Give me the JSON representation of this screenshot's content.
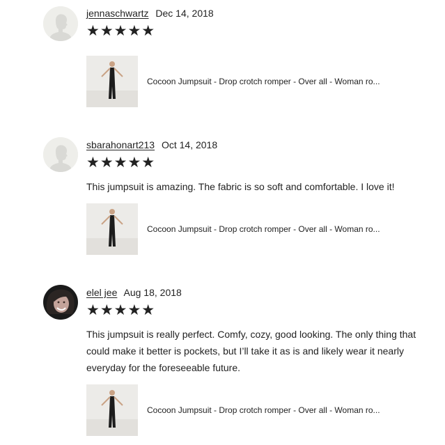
{
  "reviews": [
    {
      "username": "jennaschwartz",
      "date": "Dec 14, 2018",
      "stars": "★★★★★",
      "rating": 5,
      "text": "",
      "avatar_icon": "default-user-silhouette",
      "product_title": "Cocoon Jumpsuit - Drop crotch romper - Over all - Woman ro..."
    },
    {
      "username": "sbarahonart213",
      "date": "Oct 14, 2018",
      "stars": "★★★★★",
      "rating": 5,
      "text": "This jumpsuit is amazing. The fabric is so soft and comfortable. I love it!",
      "avatar_icon": "default-user-silhouette",
      "product_title": "Cocoon Jumpsuit - Drop crotch romper - Over all - Woman ro..."
    },
    {
      "username": "elel jee",
      "date": "Aug 18, 2018",
      "stars": "★★★★★",
      "rating": 5,
      "text": "This jumpsuit is really perfect. Comfy, cozy, good looking. The only thing that could make it better is pockets, but I’ll take it as is and likely wear it nearly everyday for the foreseeable future.",
      "avatar_icon": "user-photo",
      "product_title": "Cocoon Jumpsuit - Drop crotch romper - Over all - Woman ro..."
    }
  ]
}
